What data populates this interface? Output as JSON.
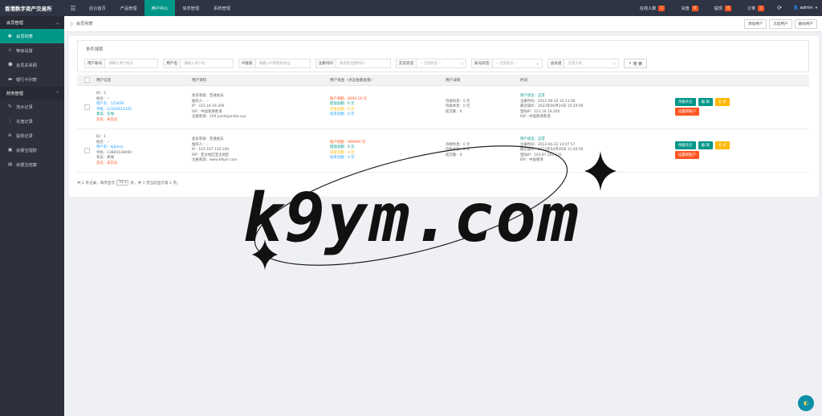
{
  "app": {
    "title": "香港数字资产交易所",
    "menu_icon": "menu-icon"
  },
  "topnav": [
    {
      "label": "后台首页",
      "active": false
    },
    {
      "label": "产品管理",
      "active": false
    },
    {
      "label": "用户中心",
      "active": true
    },
    {
      "label": "信息管理",
      "active": false
    },
    {
      "label": "系统管理",
      "active": false
    }
  ],
  "topstats": [
    {
      "label": "在线人数",
      "count": "1"
    },
    {
      "label": "充值",
      "count": "0"
    },
    {
      "label": "提现",
      "count": "0"
    },
    {
      "label": "订单",
      "count": "1"
    }
  ],
  "admin": {
    "name": "admin"
  },
  "sidebar": {
    "groups": [
      {
        "label": "会员管理",
        "items": [
          {
            "label": "会员列表",
            "icon": "user-icon",
            "active": true
          },
          {
            "label": "等级设置",
            "icon": "star-icon",
            "active": false
          },
          {
            "label": "会员关系网",
            "icon": "users-icon",
            "active": false
          },
          {
            "label": "银行卡列表",
            "icon": "card-icon",
            "active": false
          }
        ]
      },
      {
        "label": "财务管理",
        "items": [
          {
            "label": "流水记录",
            "icon": "edit-icon",
            "active": false
          },
          {
            "label": "充值记录",
            "icon": "list-icon",
            "active": false
          },
          {
            "label": "提现记录",
            "icon": "cash-icon",
            "active": false
          },
          {
            "label": "余额宝理财",
            "icon": "wallet-icon",
            "active": false
          },
          {
            "label": "余额宝结算",
            "icon": "calc-icon",
            "active": false
          }
        ]
      }
    ]
  },
  "breadcrumb": {
    "label": "会员列表"
  },
  "crumb_actions": [
    "添加用户",
    "冻结用户",
    "删除用户"
  ],
  "search": {
    "title": "条件搜索",
    "fields": [
      {
        "label": "用户账号",
        "placeholder": "请输入用户账号",
        "select": false
      },
      {
        "label": "用户名",
        "placeholder": "请输入用户名",
        "select": false
      },
      {
        "label": "IP搜索",
        "placeholder": "请输入IP或搜索地址",
        "select": false
      },
      {
        "label": "注册时间",
        "placeholder": "请选择注册时间",
        "select": false
      },
      {
        "label": "实名状态",
        "placeholder": "-- 全部状态 --",
        "select": true
      },
      {
        "label": "账号状态",
        "placeholder": "-- 全部状态 --",
        "select": true
      },
      {
        "label": "会员组",
        "placeholder": "全部方式",
        "select": true
      }
    ],
    "button": "搜 索"
  },
  "table": {
    "headers": [
      "用户信息",
      "用户资料",
      "用户资金（点击金额查看）",
      "用户详情",
      "时间"
    ],
    "rows": [
      {
        "info": [
          "ID：2",
          "姓名：--",
          "用户名：123456",
          "手机：12345612345",
          "状态：在线",
          "实名：未实名"
        ],
        "profile": [
          "会员等级：普通会员",
          "推荐人：--",
          "IP：223.16.19.200",
          "ISP：中国香港香港",
          "注册来源：204.yandiyandia.xyz"
        ],
        "funds": [
          "账户余额：8000.18 元",
          "提现总额：0 元",
          "充值总额：0 元",
          "投资总额：0 元"
        ],
        "details": [
          "待收利息：0 元",
          "待收本金：0 元",
          "成交额：0"
        ],
        "times": [
          "用户状态：正常",
          "注册时间：2022-06-24 10:11:06",
          "最近操作：2022年06月24日 10:29:56",
          "登陆IP：223.16.19.200",
          "ISP：中国香港香港"
        ],
        "actions": [
          "余额开启",
          "编 辑",
          "冻 结",
          "设置绑账户"
        ]
      },
      {
        "info": [
          "ID：1",
          "姓名：--",
          "用户名：djbinny",
          "手机：13800138000",
          "状态：离线",
          "实名：未实名"
        ],
        "profile": [
          "会员等级：普通会员",
          "推荐人：--",
          "IP：103.107.134.100",
          "ISP：亚太地区亚太地区",
          "注册来源：www.k9ym.com"
        ],
        "funds": [
          "账户余额：999900 元",
          "提现总额：0 元",
          "充值总额：0 元",
          "投资总额：0 元"
        ],
        "details": [
          "待收利息：0 元",
          "待收本金：0 元",
          "成交额：0"
        ],
        "times": [
          "用户状态：正常",
          "注册时间：2022-04-22 14:07:57",
          "最近操作：2022年04月26日 11:46:56",
          "登陆IP：103.97.201.131",
          "ISP：中国香港"
        ],
        "actions": [
          "余额开启",
          "编 辑",
          "冻 结",
          "设置绑账户"
        ]
      }
    ]
  },
  "pager": {
    "prefix": "共 2 条记录，每页显示",
    "per_page": "10",
    "suffix": "条，共 1 页当前显示第 1 页。"
  },
  "watermark": "k9ym.com",
  "colors": {
    "sidebar": "#2c313c",
    "topbar": "#2f3444",
    "accent": "#009688",
    "danger": "#ff5722",
    "warn": "#ffb800",
    "link": "#1e9fff"
  }
}
